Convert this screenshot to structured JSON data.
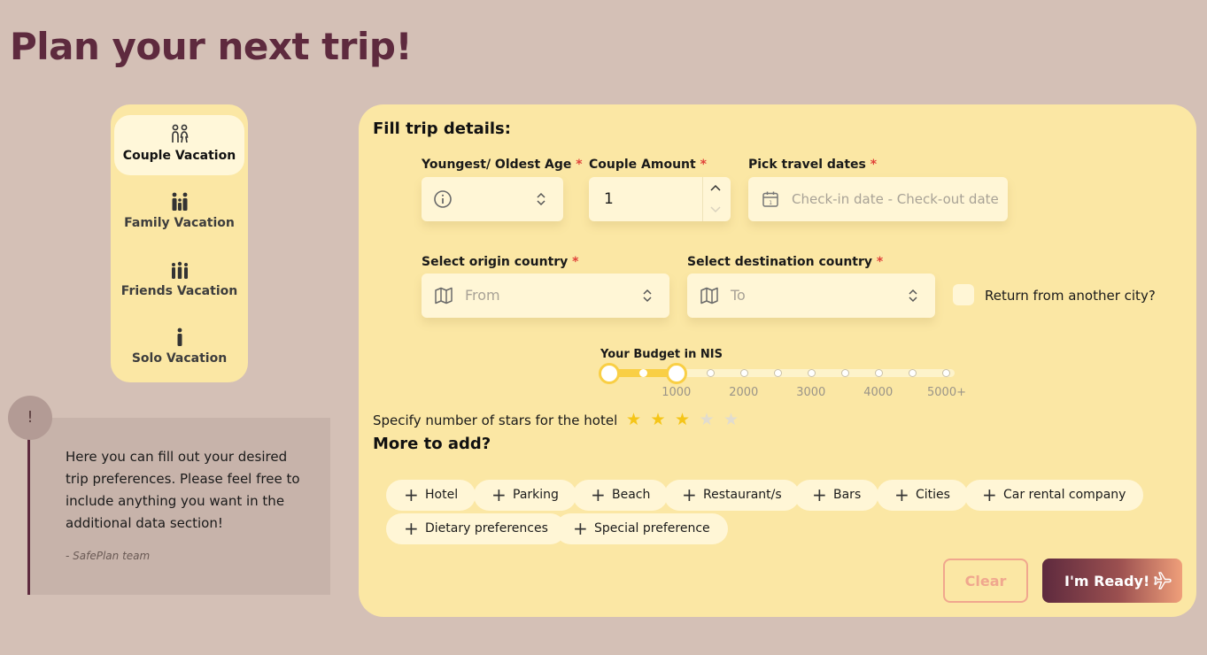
{
  "page": {
    "title": "Plan your next trip!"
  },
  "vacation_types": [
    {
      "label": "Couple Vacation",
      "icon": "couple-icon",
      "active": true
    },
    {
      "label": "Family Vacation",
      "icon": "family-icon",
      "active": false
    },
    {
      "label": "Friends Vacation",
      "icon": "friends-icon",
      "active": false
    },
    {
      "label": "Solo Vacation",
      "icon": "solo-icon",
      "active": false
    }
  ],
  "note": {
    "badge": "!",
    "text": "Here you can fill out your desired trip preferences. Please feel free to include anything you want in the additional data section!",
    "signature": "- SafePlan team"
  },
  "form": {
    "heading": "Fill trip details:",
    "required_marker": "*",
    "age": {
      "label": "Youngest/ Oldest Age"
    },
    "couples": {
      "label": "Couple Amount",
      "value": "1"
    },
    "dates": {
      "label": "Pick travel dates",
      "placeholder": "Check-in date - Check-out date"
    },
    "origin": {
      "label": "Select origin country",
      "placeholder": "From"
    },
    "destination": {
      "label": "Select destination country",
      "placeholder": "To"
    },
    "return_other_city": {
      "label": "Return from another city?",
      "checked": false
    },
    "budget": {
      "label": "Your Budget in NIS",
      "tick_labels": [
        "1000",
        "2000",
        "3000",
        "4000",
        "5000+"
      ],
      "range_fraction": [
        0,
        0.2
      ]
    },
    "stars": {
      "label": "Specify number of stars for the hotel",
      "value": 3,
      "max": 5
    },
    "more": {
      "heading": "More to add?",
      "chips": [
        "Hotel",
        "Parking",
        "Beach",
        "Restaurant/s",
        "Bars",
        "Cities",
        "Car rental company",
        "Dietary preferences",
        "Special preference"
      ]
    },
    "buttons": {
      "clear": "Clear",
      "ready": "I'm Ready!"
    }
  },
  "colors": {
    "title": "#5e2a3e",
    "panel": "#fbe7a4",
    "accent": "#f9cf45",
    "star_on": "#f5c518",
    "star_off": "#e1dccf"
  }
}
